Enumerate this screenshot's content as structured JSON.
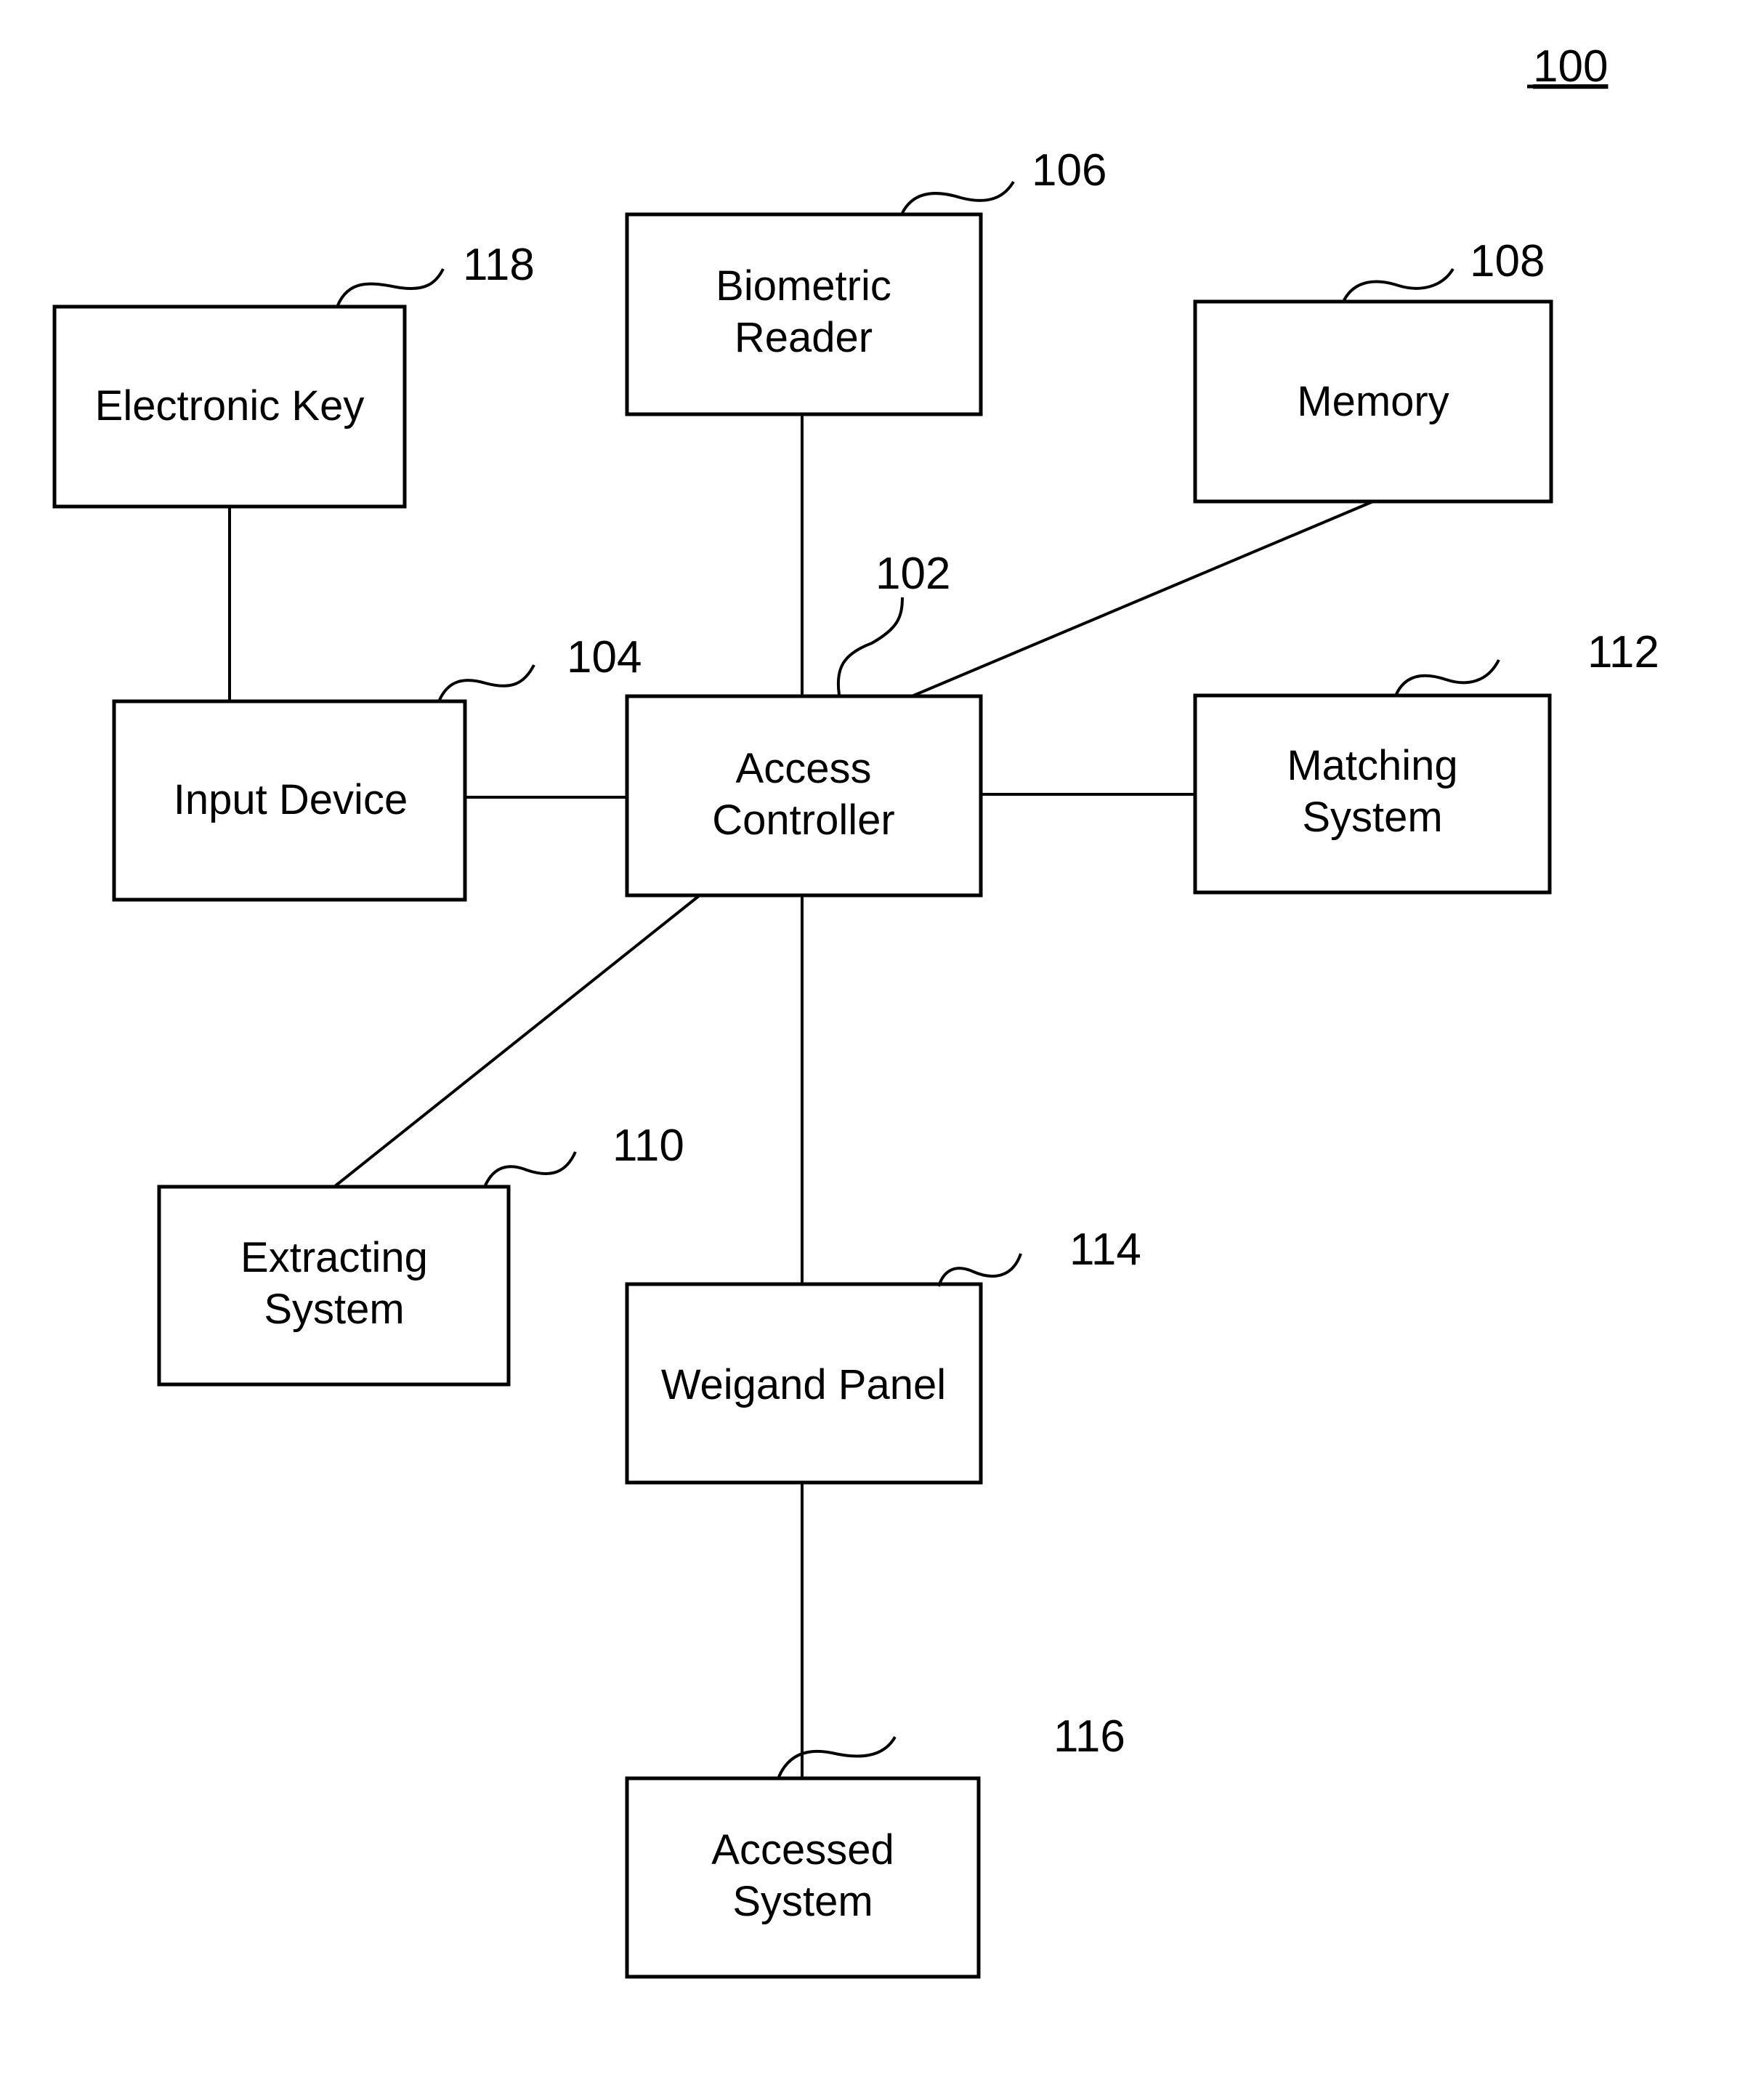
{
  "figure": {
    "label": "100"
  },
  "blocks": {
    "access_controller": {
      "ref": "102",
      "lines": [
        "Access",
        "Controller"
      ]
    },
    "input_device": {
      "ref": "104",
      "lines": [
        "Input Device"
      ]
    },
    "biometric_reader": {
      "ref": "106",
      "lines": [
        "Biometric",
        "Reader"
      ]
    },
    "memory": {
      "ref": "108",
      "lines": [
        "Memory"
      ]
    },
    "extracting_system": {
      "ref": "110",
      "lines": [
        "Extracting",
        "System"
      ]
    },
    "matching_system": {
      "ref": "112",
      "lines": [
        "Matching",
        "System"
      ]
    },
    "weigand_panel": {
      "ref": "114",
      "lines": [
        "Weigand Panel"
      ]
    },
    "accessed_system": {
      "ref": "116",
      "lines": [
        "Accessed",
        "System"
      ]
    },
    "electronic_key": {
      "ref": "118",
      "lines": [
        "Electronic Key"
      ]
    }
  },
  "connections": [
    {
      "from": "electronic_key",
      "to": "input_device"
    },
    {
      "from": "input_device",
      "to": "access_controller"
    },
    {
      "from": "biometric_reader",
      "to": "access_controller"
    },
    {
      "from": "memory",
      "to": "access_controller"
    },
    {
      "from": "access_controller",
      "to": "matching_system"
    },
    {
      "from": "access_controller",
      "to": "extracting_system"
    },
    {
      "from": "access_controller",
      "to": "weigand_panel"
    },
    {
      "from": "weigand_panel",
      "to": "accessed_system"
    }
  ]
}
